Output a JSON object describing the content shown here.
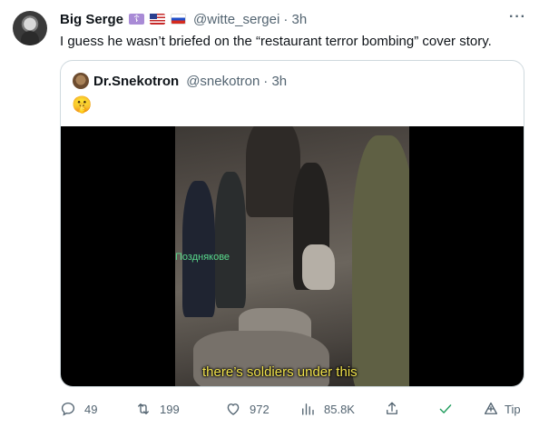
{
  "author": {
    "name": "Big Serge",
    "handle": "@witte_sergei",
    "time": "· 3h",
    "badge_cross": "☦"
  },
  "tweet_text": "I guess he wasn’t briefed on the “restaurant terror bombing” cover story.",
  "quoted": {
    "name": "Dr.Snekotron",
    "handle": "@snekotron",
    "time": "· 3h",
    "emoji": "🤫",
    "video": {
      "watermark": "Позднякове",
      "subtitle": "there’s soldiers under this"
    }
  },
  "actions": {
    "reply_count": "49",
    "retweet_count": "199",
    "like_count": "972",
    "views_count": "85.8K",
    "tip_label": "Tip"
  },
  "more_label": "···"
}
